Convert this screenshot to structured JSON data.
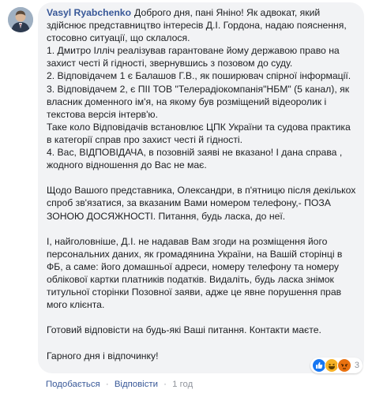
{
  "comment": {
    "author": "Vasyl Ryabchenko",
    "paragraphs": [
      "Доброго дня, пані Яніно! Як адвокат, який здійснює представництво інтересів Д.І. Гордона, надаю пояснення, стосовно ситуації, що склалося.",
      "1. Дмитро Ілліч реалізував гарантоване йому державою право на захист честі й гідності, звернувшись з позовом до суду.",
      "2. Відповідачем 1 є Балашов Г.В., як поширювач спірної інформації.",
      "3. Відповідачем 2, є ПІІ ТОВ \"Телерадіокомпанія\"НБМ\" (5 канал), як власник доменного ім'я, на якому був розміщений відеоролик і текстова версія інтерв'ю.",
      "Таке коло Відповідачів встановлює ЦПК України та судова практика в категорії справ про захист честі й гідності.",
      "4. Вас, ВІДПОВІДАЧА, в позовній заяві не вказано! І дана справа , жодного відношення до Вас не має.",
      "",
      "Щодо Вашого представника, Олександри, в п'ятницю після декількох спроб зв'язатися, за вказаним Вами номером телефону,- ПОЗА ЗОНОЮ ДОСЯЖНОСТІ. Питання, будь ласка, до неї.",
      "",
      "І, найголовніше, Д.І. не надавав Вам згоди на розміщення його персональних даних, як громадянина України, на Вашій сторінці в ФБ, а саме: його домашньої адреси, номеру телефону та номеру облікової картки платників податків. Видаліть, будь ласка знімок титульної сторінки Позовної заяви, адже це явне порушення прав мого клієнта.",
      "",
      "Готовий відповісти на будь-які Ваші питання. Контакти маєте.",
      "",
      "Гарного дня і відпочинку!"
    ]
  },
  "reactions": {
    "count": "3",
    "colors": {
      "like": "#1877f2",
      "haha": "#f7b125",
      "angry": "#e9710f"
    }
  },
  "actions": {
    "like": "Подобається",
    "reply": "Відповісти",
    "separator": "·",
    "time": "1 год"
  }
}
